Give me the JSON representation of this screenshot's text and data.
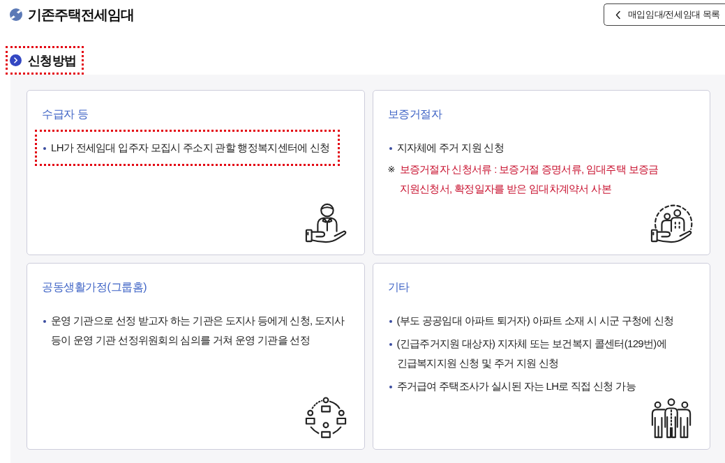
{
  "header": {
    "title": "기존주택전세임대",
    "back_button": {
      "label": "매입임대/전세임대 목록"
    }
  },
  "section": {
    "title": "신청방법",
    "highlighted": true
  },
  "cards": [
    {
      "title": "수급자 등",
      "items": [
        {
          "text": "LH가 전세임대 입주자 모집시 주소지 관할 행정복지센터에 신청",
          "highlighted": true
        }
      ]
    },
    {
      "title": "보증거절자",
      "items": [
        {
          "text": "지자체에 주거 지원 신청",
          "highlighted": false
        }
      ],
      "note": {
        "mark": "※",
        "text": "보증거절자 신청서류 : 보증거절 증명서류, 임대주택 보증금 지원신청서, 확정일자를 받은 임대차계약서 사본"
      }
    },
    {
      "title": "공동생활가정(그룹홈)",
      "items": [
        {
          "text": "운영 기관으로 선정 받고자 하는 기관은 도지사 등에게 신청, 도지사 등이 운영 기관 선정위원회의 심의를 거쳐 운영 기관을 선정",
          "highlighted": false
        }
      ]
    },
    {
      "title": "기타",
      "items": [
        {
          "text": "(부도 공공임대 아파트 퇴거자) 아파트 소재 시 시군 구청에 신청",
          "highlighted": false
        },
        {
          "text": "(긴급주거지원 대상자) 지자체 또는 보건복지 콜센터(129번)에 긴급복지지원 신청 및 주거 지원 신청",
          "highlighted": false
        },
        {
          "text": "주거급여 주택조사가 실시된 자는 LH로 직접 신청 가능",
          "highlighted": false
        }
      ]
    }
  ]
}
